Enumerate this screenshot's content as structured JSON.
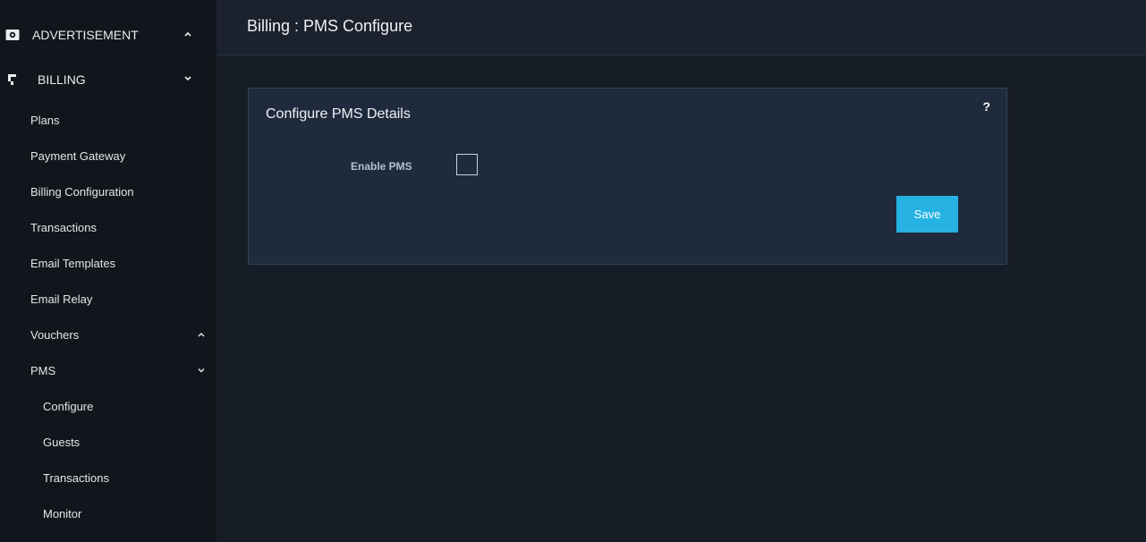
{
  "sidebar": {
    "groups": [
      {
        "label": "ADVERTISEMENT",
        "icon": "eye-card-icon",
        "chevron": "chevron-up-icon"
      },
      {
        "label": "BILLING",
        "icon": "billing-icon",
        "chevron": "chevron-down-icon"
      }
    ],
    "billing_items": [
      {
        "label": "Plans"
      },
      {
        "label": "Payment Gateway"
      },
      {
        "label": "Billing Configuration"
      },
      {
        "label": "Transactions"
      },
      {
        "label": "Email Templates"
      },
      {
        "label": "Email Relay"
      },
      {
        "label": "Vouchers",
        "chevron": "chevron-up-icon"
      },
      {
        "label": "PMS",
        "chevron": "chevron-down-icon"
      }
    ],
    "pms_items": [
      {
        "label": "Configure"
      },
      {
        "label": "Guests"
      },
      {
        "label": "Transactions"
      },
      {
        "label": "Monitor"
      }
    ]
  },
  "header": {
    "title": "Billing : PMS Configure"
  },
  "card": {
    "title": "Configure PMS Details",
    "help_label": "?",
    "enable_pms_label": "Enable PMS",
    "enable_pms_checked": false,
    "save_label": "Save"
  },
  "colors": {
    "sidebar_bg": "#12161c",
    "main_bg": "#171d26",
    "card_bg": "#1f2b3d",
    "accent": "#26b3e4"
  }
}
